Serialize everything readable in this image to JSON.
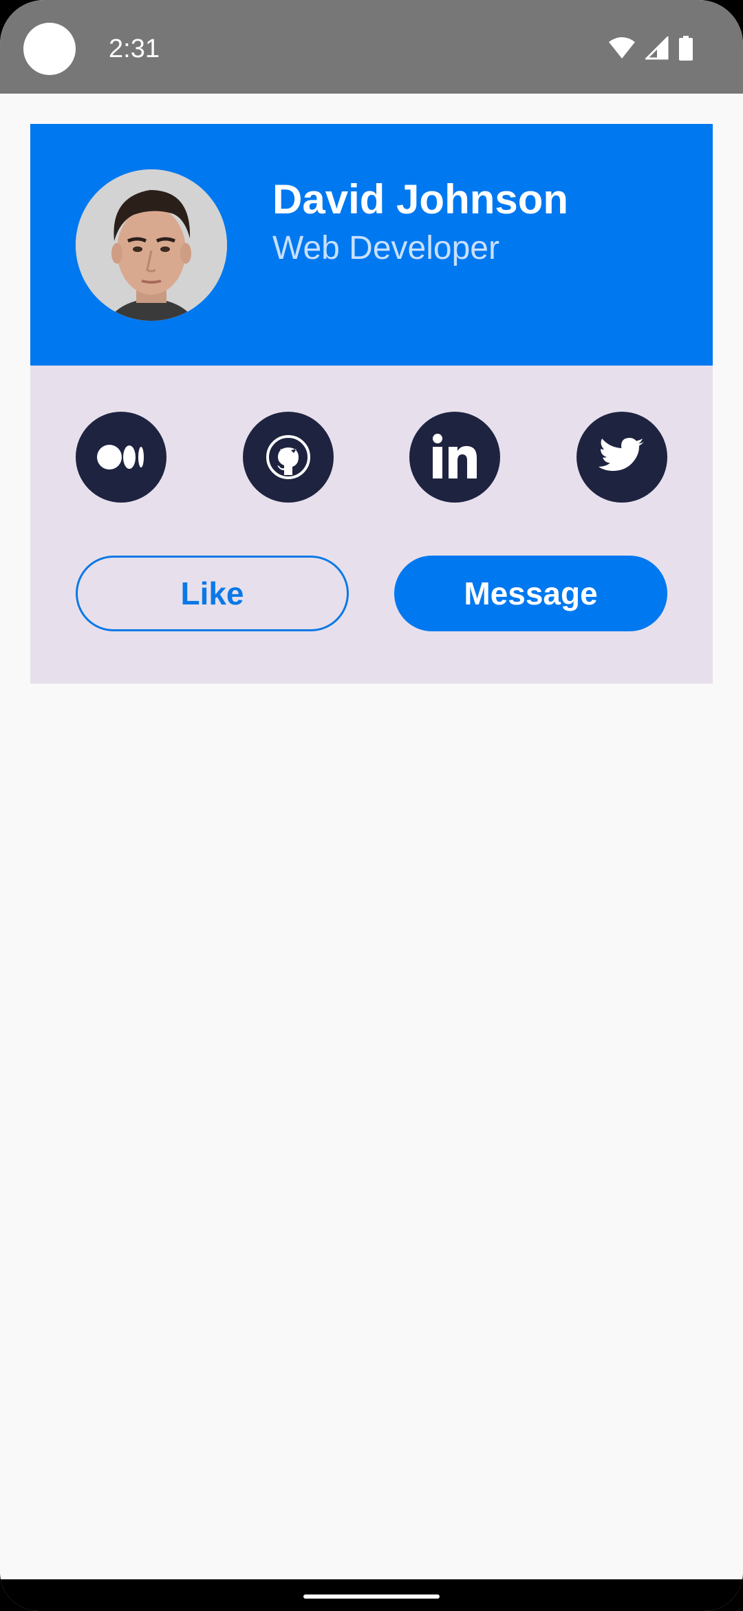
{
  "status_bar": {
    "time": "2:31",
    "icons": [
      "camera-cutout-icon",
      "wifi-icon",
      "cellular-signal-icon",
      "battery-icon"
    ]
  },
  "profile": {
    "name": "David Johnson",
    "role": "Web Developer",
    "avatar": "profile-photo"
  },
  "social": [
    {
      "name": "medium",
      "icon": "medium-icon"
    },
    {
      "name": "github",
      "icon": "github-icon"
    },
    {
      "name": "linkedin",
      "icon": "linkedin-icon"
    },
    {
      "name": "twitter",
      "icon": "twitter-icon"
    }
  ],
  "actions": {
    "like_label": "Like",
    "message_label": "Message"
  },
  "colors": {
    "header_blue": "#0078f0",
    "card_bg": "#e7e0ec",
    "social_circle": "#1e2340",
    "status_bar": "#777777",
    "page_bg": "#f9f9f9",
    "role_text": "#c8e0ff"
  },
  "nav_bar": {
    "handle": "gesture-handle"
  }
}
